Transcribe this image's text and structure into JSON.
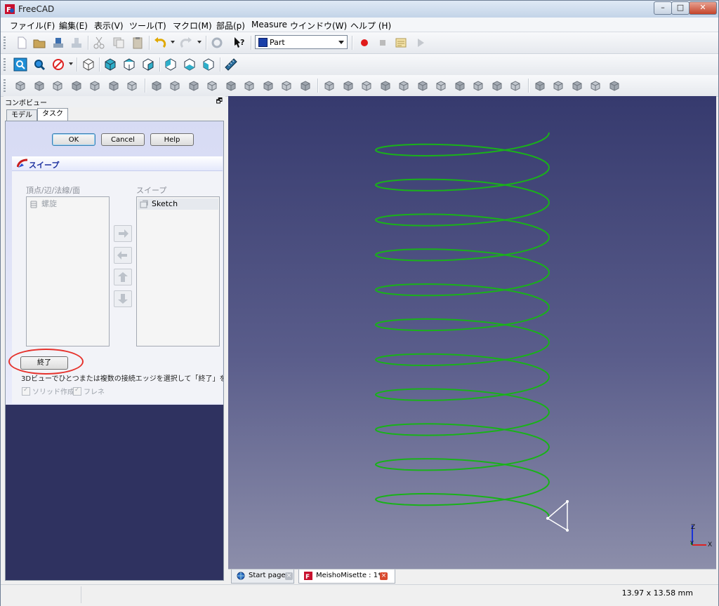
{
  "window": {
    "title": "FreeCAD",
    "controls": {
      "minimize": "–",
      "maximize": "□",
      "close": "✕"
    }
  },
  "menu": [
    "ファイル(F)",
    "編集(E)",
    "表示(V)",
    "ツール(T)",
    "マクロ(M)",
    "部品(p)",
    "Measure",
    "ウインドウ(W)",
    "ヘルプ (H)"
  ],
  "toolbar": {
    "workbench": "Part",
    "icons_row1": [
      "new-file-icon",
      "open-file-icon",
      "save-icon",
      "save-as-icon",
      "cut-icon",
      "copy-icon",
      "paste-icon",
      "undo-icon",
      "redo-icon",
      "refresh-icon",
      "whats-this-icon",
      "record-macro-icon",
      "stop-macro-icon",
      "edit-macro-icon",
      "run-macro-icon"
    ],
    "icons_row2": [
      "fit-all-icon",
      "fit-selection-icon",
      "draw-style-icon",
      "axonometric-view-icon",
      "front-view-icon",
      "top-view-icon",
      "right-view-icon",
      "rear-view-icon",
      "bottom-view-icon",
      "left-view-icon",
      "measure-distance-icon"
    ],
    "icons_row3": [
      "box-icon",
      "cylinder-icon",
      "sphere-icon",
      "cone-icon",
      "torus-icon",
      "create-primitives-icon",
      "shape-builder-icon",
      "extrude-icon",
      "revolve-icon",
      "mirror-icon",
      "fillet-icon",
      "chamfer-icon",
      "make-face-icon",
      "ruled-surface-icon",
      "loft-icon",
      "sweep-icon",
      "section-icon",
      "cross-sections-icon",
      "offset-icon",
      "boolean-icon",
      "cut-icon",
      "fuse-icon",
      "common-icon",
      "join-icon",
      "split-icon",
      "compound-icon",
      "check-geometry-icon",
      "defeaturing-icon",
      "attachment-icon",
      "refine-shape-icon",
      "thickness-icon",
      "projection-icon"
    ]
  },
  "combo_view": {
    "title": "コンボビュー",
    "undock": "🗗",
    "tabs": [
      "モデル",
      "タスク"
    ],
    "active_tab": 1,
    "buttons": {
      "ok": "OK",
      "cancel": "Cancel",
      "help": "Help"
    },
    "taskbox": {
      "title": "スイープ",
      "left_label": "頂点/辺/法線/面",
      "right_label": "スイープ",
      "left_items": [
        "螺旋"
      ],
      "right_items": [
        "Sketch"
      ],
      "finish_button": "終了",
      "hint": "3Dビューでひとつまたは複数の接続エッジを選択して「終了」を押してくださ",
      "solid_label": "ソリッド作成",
      "frenet_label": "フレネ",
      "solid_checked": true,
      "frenet_checked": true
    }
  },
  "view": {
    "background_top": "#363a6e",
    "background_bottom": "#8c8eaa",
    "helix_color": "#19b219",
    "profile_color": "#ffffff",
    "axis_labels": {
      "z": "Z",
      "y": "Y",
      "x": "X"
    }
  },
  "doc_tabs": [
    {
      "label": "Start page",
      "active": false
    },
    {
      "label": "MeishoMisette : 1*",
      "active": true
    }
  ],
  "status": {
    "dimensions": "13.97 x 13.58 mm"
  },
  "colors": {
    "accent": "#1b2f9e",
    "highlight_ring": "#e6322c"
  }
}
